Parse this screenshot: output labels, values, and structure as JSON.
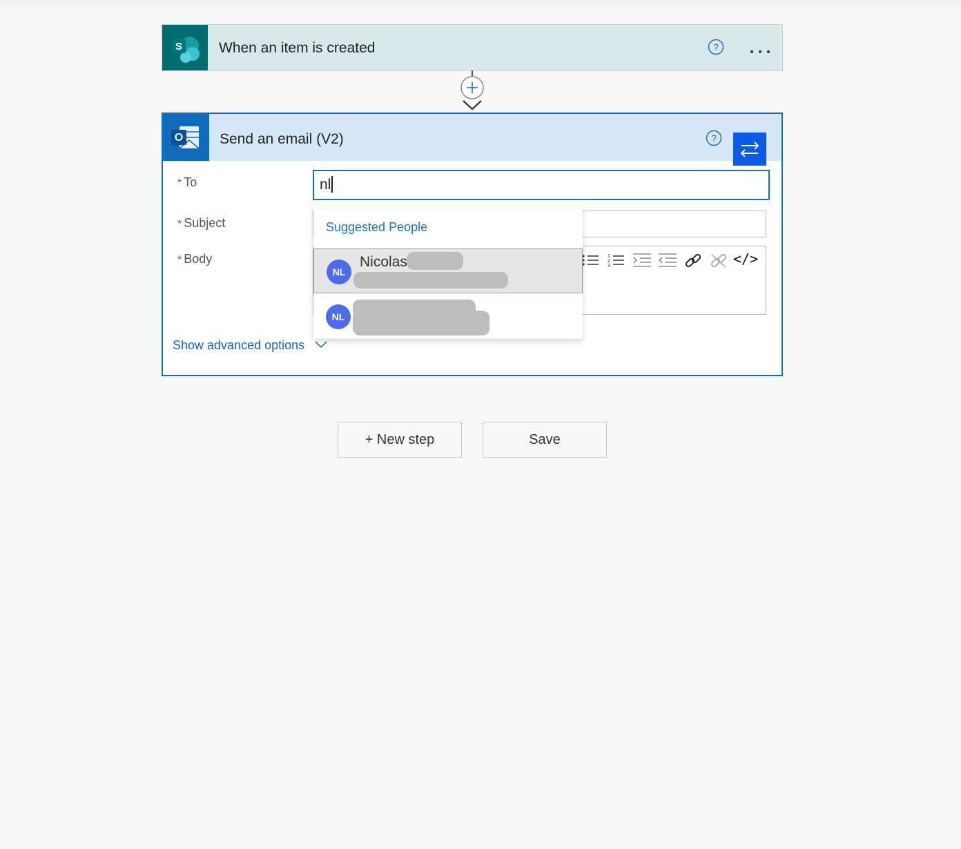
{
  "trigger": {
    "title": "When an item is created",
    "icon": "sharepoint-icon",
    "icon_letter": "S",
    "help_icon": "help-icon",
    "more_icon": "more-icon"
  },
  "connector": {
    "add_icon": "plus-circle-icon",
    "arrow_icon": "chevron-down-icon"
  },
  "action": {
    "title": "Send an email (V2)",
    "icon": "outlook-icon",
    "icon_letter": "O",
    "help_icon": "help-icon",
    "swap_icon": "swap-arrows-icon",
    "required_mark": "*",
    "fields": {
      "to": {
        "label": "To",
        "value": "nl"
      },
      "subject": {
        "label": "Subject",
        "value": ""
      },
      "body": {
        "label": "Body",
        "value": ""
      }
    },
    "toolbar": [
      "bullet-list-icon",
      "numbered-list-icon",
      "indent-icon",
      "outdent-icon",
      "link-icon",
      "unlink-icon",
      "code-view-icon"
    ],
    "toolbar_code_label": "</>",
    "advanced_label": "Show advanced options"
  },
  "suggestions": {
    "header": "Suggested People",
    "people": [
      {
        "initials": "NL",
        "name": "Nicolas",
        "selected": true
      },
      {
        "initials": "NL",
        "name": "",
        "selected": false
      }
    ]
  },
  "buttons": {
    "new_step": "+ New step",
    "save": "Save"
  },
  "colors": {
    "trigger_header": "#d9e8e8",
    "sharepoint": "#036c70",
    "action_header": "#d6e8f8",
    "outlook": "#0f6cbd",
    "accent_border": "#1370b8",
    "link": "#1567b8",
    "avatar": "#4f6bed"
  }
}
